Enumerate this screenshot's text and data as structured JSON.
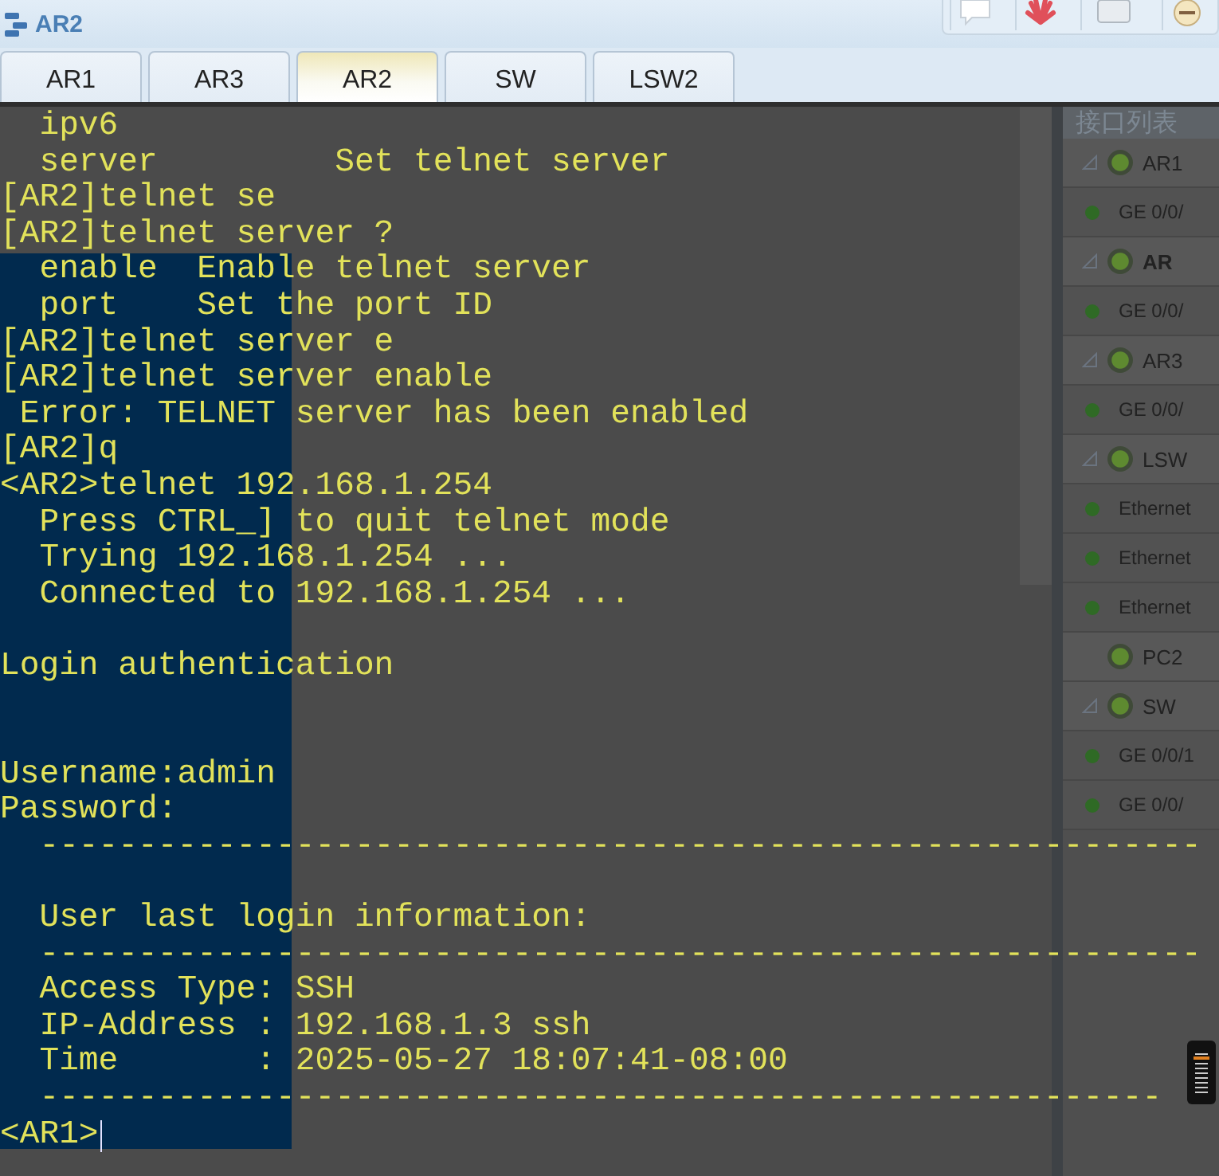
{
  "window": {
    "title": "AR2"
  },
  "tabs": [
    {
      "label": "AR1",
      "selected": false
    },
    {
      "label": "AR3",
      "selected": false
    },
    {
      "label": "AR2",
      "selected": true
    },
    {
      "label": "SW",
      "selected": false
    },
    {
      "label": "LSW2",
      "selected": false
    }
  ],
  "terminal": {
    "lines": [
      {
        "kind": "text",
        "text": "  ipv6"
      },
      {
        "kind": "text",
        "text": "  server         Set telnet server"
      },
      {
        "kind": "text",
        "text": "[AR2]telnet se"
      },
      {
        "kind": "text",
        "text": "[AR2]telnet server ?"
      },
      {
        "kind": "text",
        "text": "  enable  Enable telnet server"
      },
      {
        "kind": "text",
        "text": "  port    Set the port ID"
      },
      {
        "kind": "text",
        "text": "[AR2]telnet server e"
      },
      {
        "kind": "text",
        "text": "[AR2]telnet server enable"
      },
      {
        "kind": "text",
        "text": " Error: TELNET server has been enabled"
      },
      {
        "kind": "text",
        "text": "[AR2]q"
      },
      {
        "kind": "text",
        "text": "<AR2>telnet 192.168.1.254"
      },
      {
        "kind": "text",
        "text": "  Press CTRL_] to quit telnet mode"
      },
      {
        "kind": "text",
        "text": "  Trying 192.168.1.254 ..."
      },
      {
        "kind": "text",
        "text": "  Connected to 192.168.1.254 ..."
      },
      {
        "kind": "blank"
      },
      {
        "kind": "text",
        "text": "Login authentication"
      },
      {
        "kind": "blank"
      },
      {
        "kind": "blank"
      },
      {
        "kind": "text",
        "text": "Username:admin"
      },
      {
        "kind": "text",
        "text": "Password:"
      },
      {
        "kind": "rule",
        "text": "  -----------------------------------------------------------"
      },
      {
        "kind": "blank"
      },
      {
        "kind": "text",
        "text": "  User last login information:"
      },
      {
        "kind": "rule",
        "text": "  -----------------------------------------------------------"
      },
      {
        "kind": "text",
        "text": "  Access Type: SSH"
      },
      {
        "kind": "text",
        "text": "  IP-Address : 192.168.1.3 ssh"
      },
      {
        "kind": "text",
        "text": "  Time       : 2025-05-27 18:07:41-08:00"
      },
      {
        "kind": "rule",
        "text": "  ---------------------------------------------------------"
      },
      {
        "kind": "prompt",
        "text": "<AR1>"
      }
    ]
  },
  "zoom_slider": {
    "level": 0.75
  },
  "interface_list": {
    "title": "接口列表",
    "devices": [
      {
        "name": "AR1",
        "selected": false,
        "expandable": true,
        "children": [
          {
            "name": "GE 0/0/"
          }
        ]
      },
      {
        "name": "AR",
        "selected": true,
        "expandable": true,
        "children": [
          {
            "name": "GE 0/0/"
          }
        ]
      },
      {
        "name": "AR3",
        "selected": false,
        "expandable": true,
        "children": [
          {
            "name": "GE 0/0/"
          }
        ]
      },
      {
        "name": "LSW",
        "selected": false,
        "expandable": true,
        "children": [
          {
            "name": "Ethernet"
          },
          {
            "name": "Ethernet"
          },
          {
            "name": "Ethernet"
          }
        ]
      },
      {
        "name": "PC2",
        "selected": false,
        "expandable": false
      },
      {
        "name": "SW",
        "selected": false,
        "expandable": true,
        "children": [
          {
            "name": "GE 0/0/1"
          },
          {
            "name": "GE 0/0/"
          }
        ]
      }
    ]
  }
}
